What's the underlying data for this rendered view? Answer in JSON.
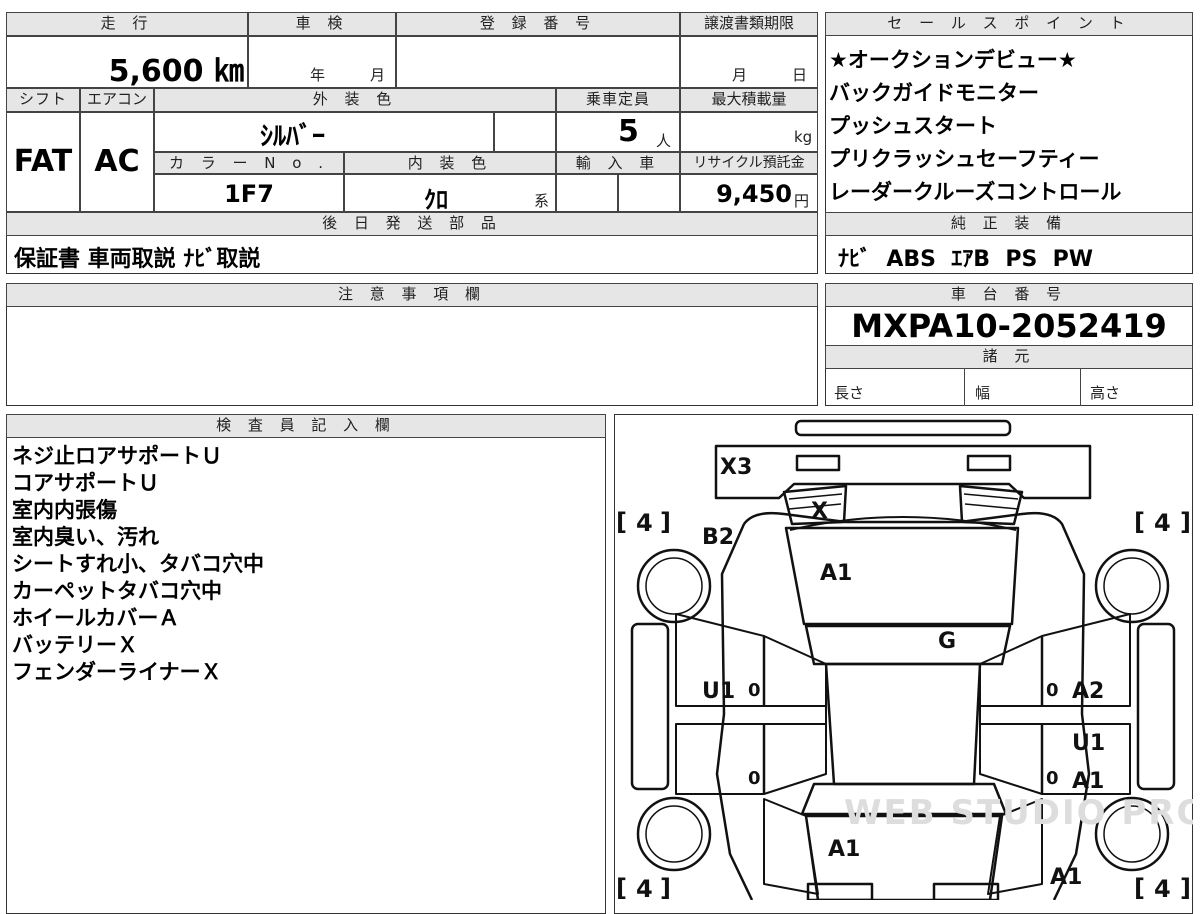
{
  "top_header": {
    "mileage_label": "走 行",
    "inspection_label": "車 検",
    "registration_label": "登 録 番 号",
    "transfer_deadline_label": "譲渡書類期限",
    "sales_point_label": "セ ー ル ス ポ イ ン ト"
  },
  "mileage_value": "5,600 ㎞",
  "inspection_year": "年",
  "inspection_month": "月",
  "transfer_month": "月",
  "transfer_day": "日",
  "row2_labels": {
    "shift": "シフト",
    "aircon": "エアコン",
    "exterior_color": "外 装 色",
    "capacity": "乗車定員",
    "max_load": "最大積載量"
  },
  "shift_value": "FAT",
  "aircon_value": "AC",
  "exterior_color_value": "ｼﾙﾊﾞｰ",
  "capacity_value": "5",
  "capacity_unit": "人",
  "max_load_unit": "kg",
  "row3_labels": {
    "color_no": "カ ラ ー N o .",
    "interior_color": "内 装 色",
    "import": "輸 入 車",
    "recycle": "リサイクル預託金"
  },
  "color_no_value": "1F7",
  "interior_color_value": "ｸﾛ",
  "interior_color_suffix": "系",
  "recycle_value": "9,450",
  "recycle_unit": "円",
  "later_parts_label": "後 日 発 送 部 品",
  "later_parts_value": "保証書 車両取説 ﾅﾋﾞ取説",
  "sales_points": [
    "★オークションデビュー★",
    "バックガイドモニター",
    "プッシュスタート",
    "プリクラッシュセーフティー",
    "レーダークルーズコントロール"
  ],
  "genuine_equipment_label": "純 正 装 備",
  "genuine_equipment_value": "ﾅﾋﾞ  ABS  ｴｱB  PS  PW",
  "caution_label": "注 意 事 項 欄",
  "chassis_label": "車 台 番 号",
  "chassis_value": "MXPA10-2052419",
  "specs_label": "諸 元",
  "spec_length": "長さ",
  "spec_width": "幅",
  "spec_height": "高さ",
  "inspector_label": "検 査 員 記 入 欄",
  "inspector_notes": [
    "ネジ止ロアサポートＵ",
    "コアサポートＵ",
    "室内内張傷",
    "室内臭い、汚れ",
    "シートすれ小、タバコ穴中",
    "カーペットタバコ穴中",
    "ホイールカバーＡ",
    "バッテリーＸ",
    "フェンダーライナーＸ"
  ],
  "diagram": {
    "marks": {
      "rear_bumper": "X3",
      "rear_glass": "X",
      "trunk": "B2",
      "roof": "A1",
      "windshield_front": "G",
      "left_door_front": "U1",
      "right_door_front": "A2",
      "right_door_rear_upper": "U1",
      "right_door_rear": "A1",
      "hood": "A1",
      "front_right_corner": "A1"
    },
    "tire_depth": "4",
    "zero": "0",
    "watermark": "WEB STUDIO PRO"
  }
}
